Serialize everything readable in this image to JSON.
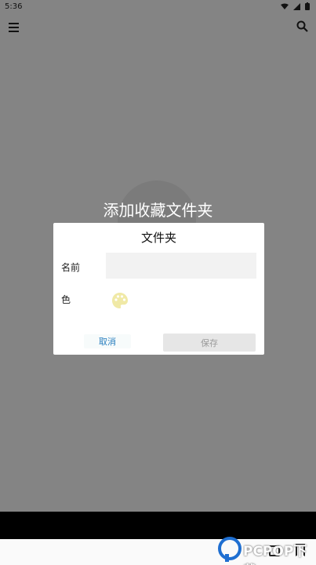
{
  "status_bar": {
    "time": "5:36",
    "icons": [
      "wifi-icon",
      "signal-icon",
      "battery-icon"
    ]
  },
  "toolbar": {
    "menu_icon": "menu-icon",
    "search_icon": "search-icon"
  },
  "page": {
    "header_title": "添加收藏文件夹"
  },
  "dialog": {
    "title": "文件夹",
    "name_label": "名前",
    "name_value": "",
    "color_label": "色",
    "palette_icon": "palette-icon",
    "cancel_label": "取消",
    "save_label": "保存"
  },
  "watermark": {
    "text": "PCPOP下载",
    "logo": "pcpop-logo"
  },
  "colors": {
    "accent": "#2a7fbf",
    "dialog_bg": "#ffffff",
    "scrim": "rgba(0,0,0,0.47)",
    "nav_bar": "#000000",
    "palette": "#f0e9a6"
  }
}
